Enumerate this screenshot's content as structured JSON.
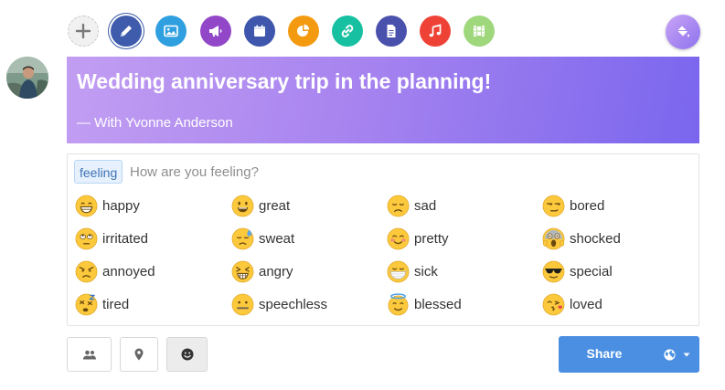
{
  "toolbar": {
    "buttons": [
      {
        "name": "add",
        "color": "#f1f1f1"
      },
      {
        "name": "pencil",
        "color": "#3f5cac"
      },
      {
        "name": "image",
        "color": "#2f9fe0"
      },
      {
        "name": "megaphone",
        "color": "#9147c7"
      },
      {
        "name": "calendar",
        "color": "#3e56ac"
      },
      {
        "name": "pie-chart",
        "color": "#f39a10"
      },
      {
        "name": "link",
        "color": "#16c0a0"
      },
      {
        "name": "document",
        "color": "#4a51ac"
      },
      {
        "name": "music",
        "color": "#ef4236"
      },
      {
        "name": "film",
        "color": "#9fd77d"
      }
    ],
    "paint_color": "#a57cf0"
  },
  "post": {
    "title": "Wedding anniversary trip in the planning!",
    "with_text": "— With Yvonne Anderson"
  },
  "feeling_box": {
    "chip_label": "feeling",
    "placeholder": "How are you feeling?",
    "feelings": [
      {
        "label": "happy",
        "icon": "grinning-face"
      },
      {
        "label": "great",
        "icon": "smiling-face"
      },
      {
        "label": "sad",
        "icon": "sad-face"
      },
      {
        "label": "bored",
        "icon": "unamused-face"
      },
      {
        "label": "irritated",
        "icon": "eye-roll-face"
      },
      {
        "label": "sweat",
        "icon": "sweat-face"
      },
      {
        "label": "pretty",
        "icon": "blushing-face"
      },
      {
        "label": "shocked",
        "icon": "screaming-face"
      },
      {
        "label": "annoyed",
        "icon": "angry-face"
      },
      {
        "label": "angry",
        "icon": "tired-face"
      },
      {
        "label": "sick",
        "icon": "mask-face"
      },
      {
        "label": "special",
        "icon": "sunglasses-face"
      },
      {
        "label": "tired",
        "icon": "dizzy-face"
      },
      {
        "label": "speechless",
        "icon": "zipper-face"
      },
      {
        "label": "blessed",
        "icon": "halo-face"
      },
      {
        "label": "loved",
        "icon": "kissing-face"
      }
    ]
  },
  "footer": {
    "share_label": "Share",
    "privacy_icon": "globe-icon"
  }
}
